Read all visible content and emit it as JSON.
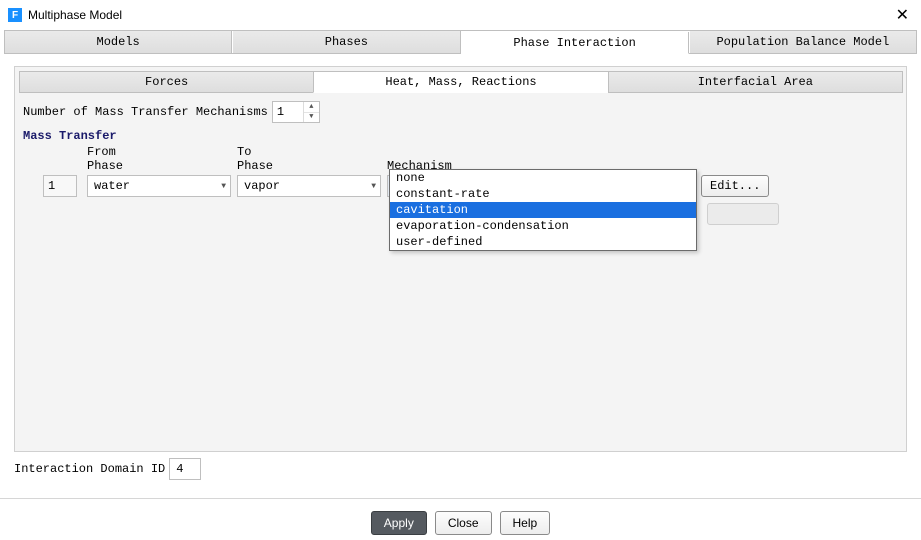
{
  "window": {
    "title": "Multiphase Model",
    "icon_letter": "F"
  },
  "tabs": {
    "items": [
      "Models",
      "Phases",
      "Phase Interaction",
      "Population Balance Model"
    ],
    "active_index": 2
  },
  "subtabs": {
    "items": [
      "Forces",
      "Heat, Mass, Reactions",
      "Interfacial Area"
    ],
    "active_index": 1
  },
  "mass_transfer": {
    "count_label": "Number of Mass Transfer Mechanisms",
    "count_value": "1",
    "section_title": "Mass Transfer",
    "headers": {
      "from_l1": "From",
      "from_l2": "Phase",
      "to_l1": "To",
      "to_l2": "Phase",
      "mechanism": "Mechanism"
    },
    "row": {
      "index": "1",
      "from_phase": "water",
      "to_phase": "vapor",
      "mechanism": "cavitation",
      "edit_label": "Edit..."
    },
    "mechanism_options": [
      "none",
      "constant-rate",
      "cavitation",
      "evaporation-condensation",
      "user-defined"
    ],
    "mechanism_hover_index": 2
  },
  "footer": {
    "domain_label": "Interaction Domain ID",
    "domain_value": "4"
  },
  "buttons": {
    "apply": "Apply",
    "close": "Close",
    "help": "Help"
  }
}
